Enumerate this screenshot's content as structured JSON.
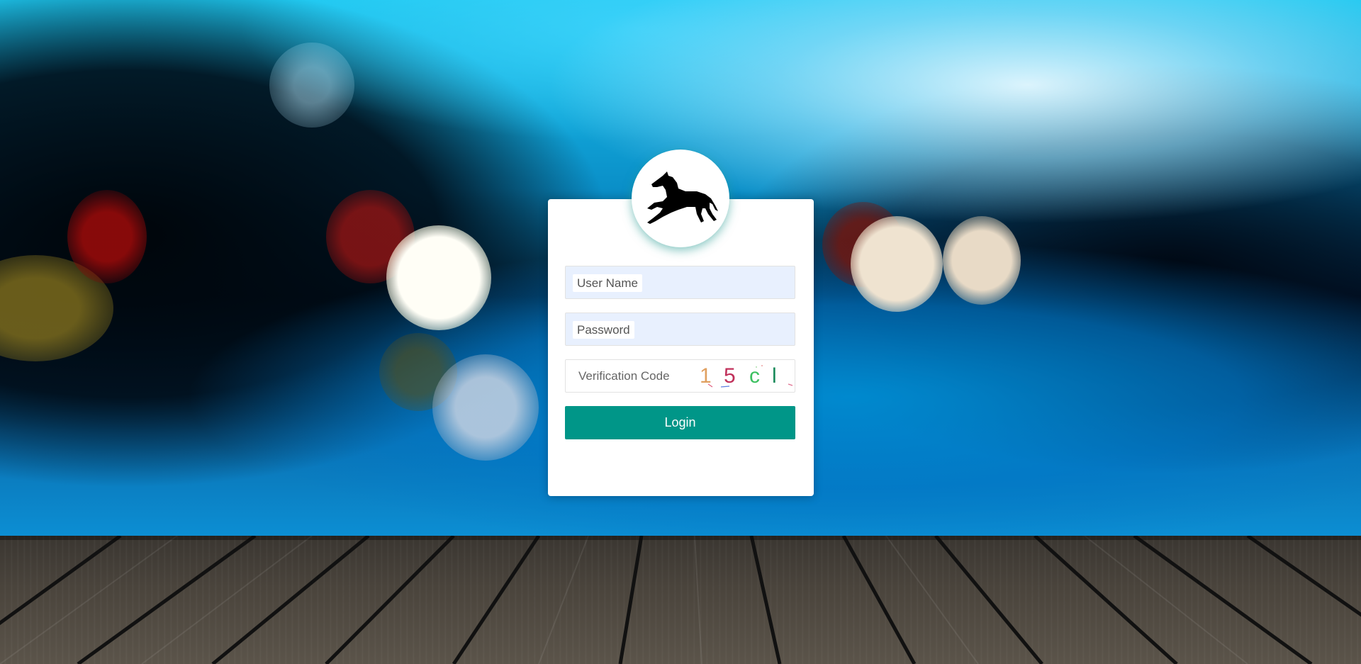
{
  "login_form": {
    "username_placeholder": "User Name",
    "password_placeholder": "Password",
    "verification_placeholder": "Verification Code",
    "captcha_chars": [
      "1",
      "5",
      "c",
      "l"
    ],
    "captcha_colors": [
      "#e0a060",
      "#c0305a",
      "#3cc060",
      "#1a8a5a"
    ],
    "login_label": "Login"
  },
  "logo": {
    "icon": "horse-icon"
  },
  "colors": {
    "accent": "#009688",
    "autofill_bg": "#e8f0fe"
  }
}
